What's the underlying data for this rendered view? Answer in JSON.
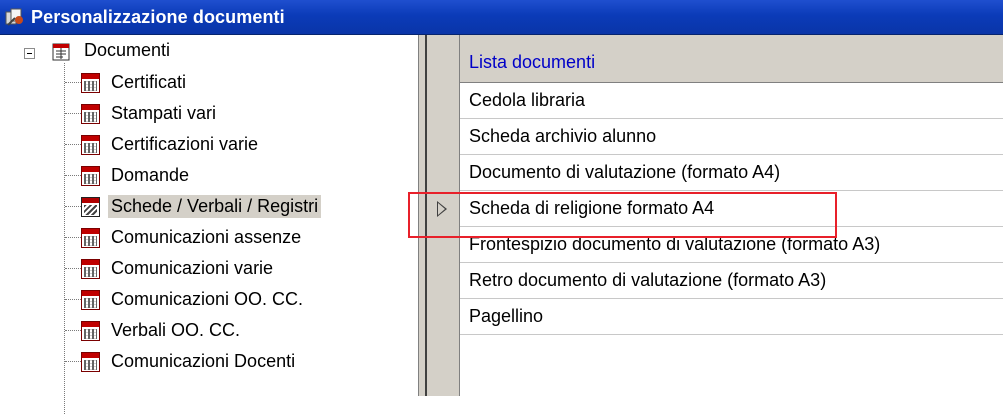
{
  "window": {
    "title": "Personalizzazione documenti",
    "title_bar_color": "#0a35a8"
  },
  "tree": {
    "root_label": "Documenti",
    "root_icon": "document-folder-icon",
    "items": [
      {
        "label": "Certificati",
        "icon": "document-grid-icon"
      },
      {
        "label": "Stampati vari",
        "icon": "document-grid-icon"
      },
      {
        "label": "Certificazioni varie",
        "icon": "document-grid-icon"
      },
      {
        "label": "Domande",
        "icon": "document-grid-icon"
      },
      {
        "label": "Schede / Verbali / Registri",
        "icon": "document-edit-icon",
        "selected": true
      },
      {
        "label": "Comunicazioni assenze",
        "icon": "document-grid-icon"
      },
      {
        "label": "Comunicazioni varie",
        "icon": "document-grid-icon"
      },
      {
        "label": "Comunicazioni OO. CC.",
        "icon": "document-grid-icon"
      },
      {
        "label": "Verbali OO. CC.",
        "icon": "document-grid-icon"
      },
      {
        "label": "Comunicazioni Docenti",
        "icon": "document-grid-icon"
      }
    ]
  },
  "grid": {
    "header": "Lista documenti",
    "header_color": "#0000c8",
    "rows": [
      "Cedola libraria",
      "Scheda archivio alunno",
      "Documento di valutazione (formato A4)",
      "Scheda di religione formato A4",
      "Frontespizio documento di valutazione (formato A3)",
      "Retro documento di valutazione (formato A3)",
      "Pagellino"
    ],
    "current_row": 3,
    "highlight_color": "#e8202a"
  }
}
